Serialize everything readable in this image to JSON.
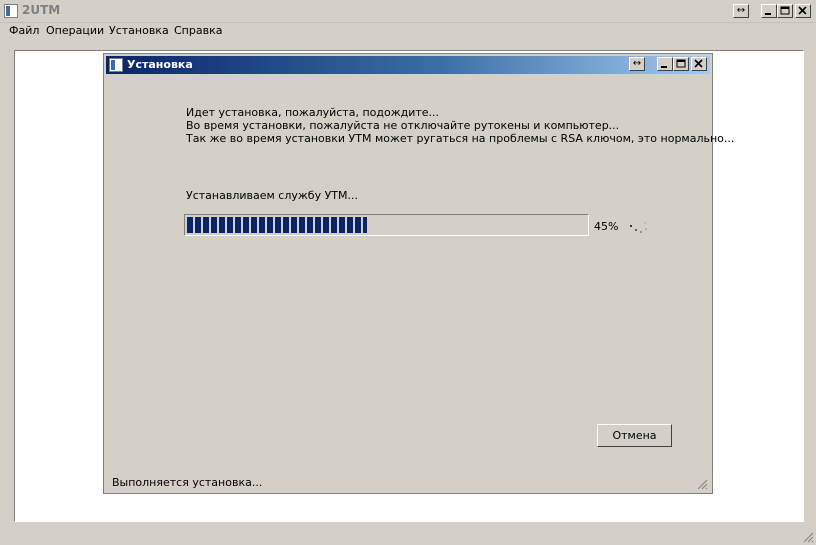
{
  "window": {
    "title": "2UTM",
    "restore_glyph": "↔",
    "controls": [
      "minimize-icon",
      "maximize-icon",
      "close-icon"
    ]
  },
  "menu": {
    "items": [
      "Файл",
      "Операции",
      "Установка",
      "Справка"
    ]
  },
  "dialog": {
    "title": "Установка",
    "restore_glyph": "↔",
    "messages": [
      "Идет установка, пожалуйста, подождите...",
      "Во время установки, пожалуйста не отключайте рутокены и компьютер...",
      "Так же во время установки УТМ может ругаться на проблемы с RSA ключом, это нормально..."
    ],
    "step_label": "Устанавливаем службу УТМ...",
    "progress": {
      "value": 45,
      "text": "45%"
    },
    "cancel_label": "Отмена",
    "status_text": "Выполняется установка...",
    "icons": [
      "app-icon",
      "spinner-icon",
      "resize-grip-icon"
    ]
  },
  "colors": {
    "dialog_title_start": "#0a246a",
    "dialog_title_end": "#a6caf0",
    "progress_fill": "#0a246a",
    "face": "#d4d0c8"
  }
}
